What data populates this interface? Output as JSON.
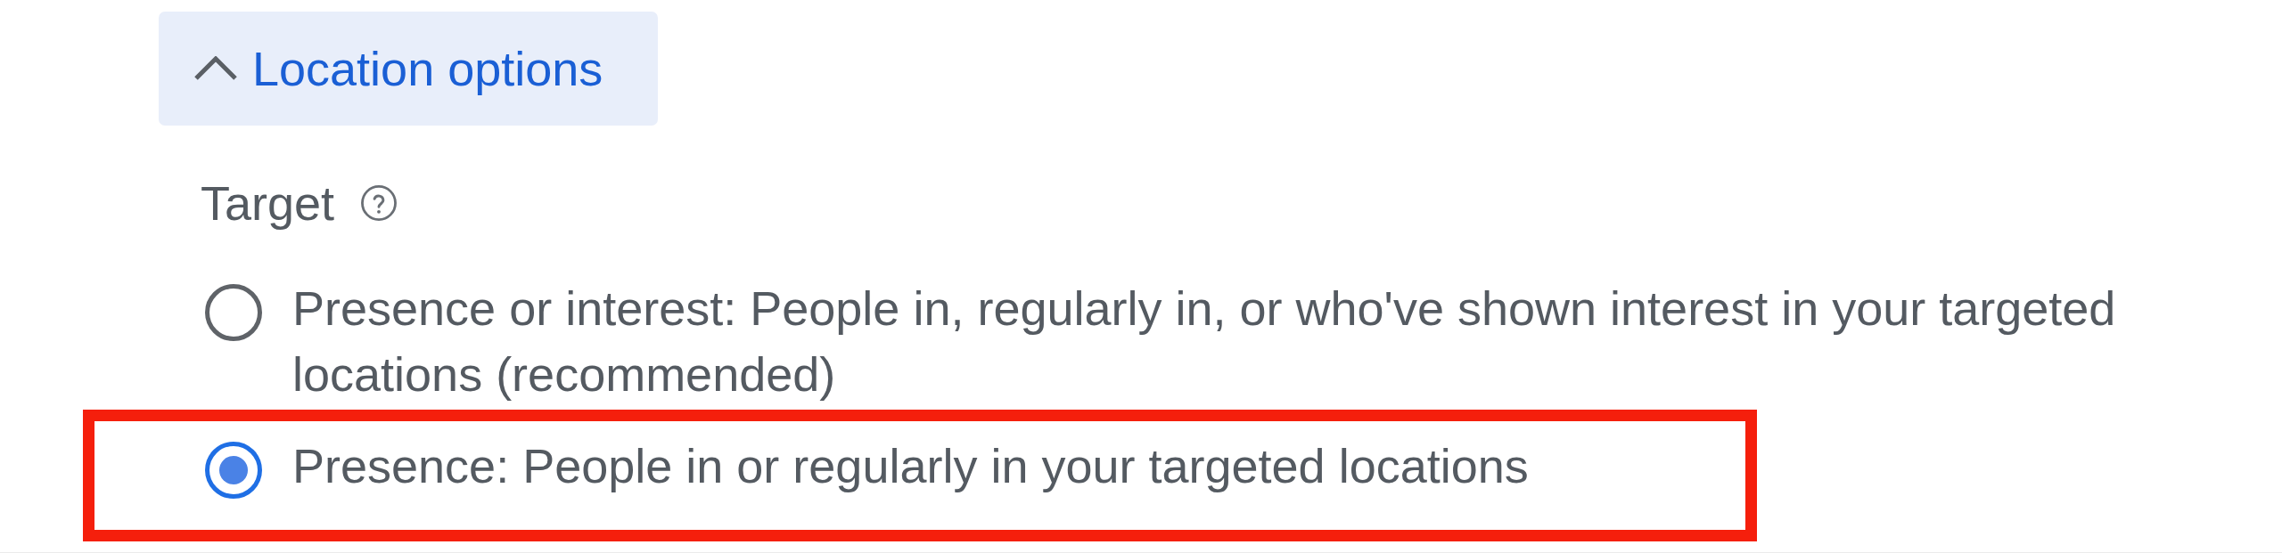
{
  "location_options": {
    "label": "Location options",
    "expanded": true
  },
  "target": {
    "label": "Target",
    "options": [
      {
        "label": "Presence or interest: People in, regularly in, or who've shown interest in your targeted locations (recommended)",
        "selected": false,
        "highlighted": false
      },
      {
        "label": "Presence: People in or regularly in your targeted locations",
        "selected": true,
        "highlighted": true
      }
    ]
  }
}
